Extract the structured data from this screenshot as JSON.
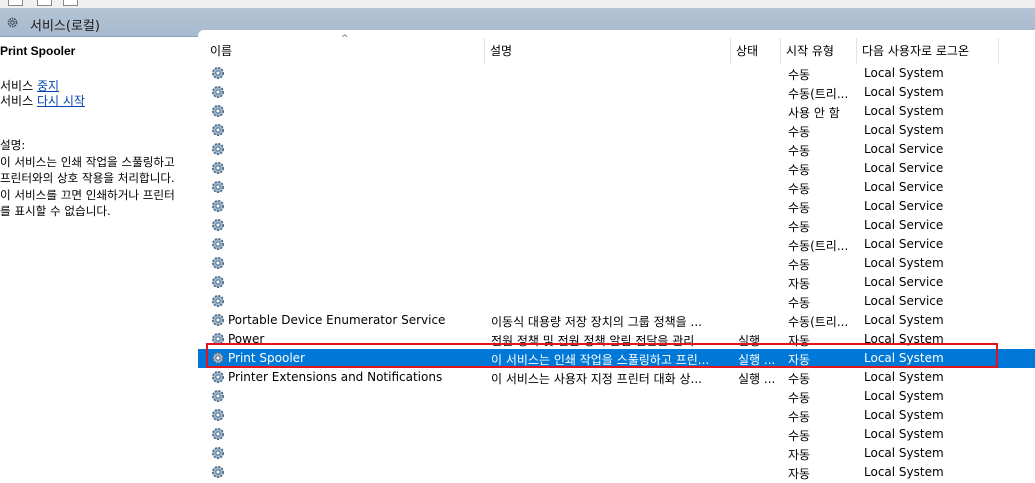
{
  "window": {
    "title": "서비스(로컬)"
  },
  "left_panel": {
    "service_title": "Print Spooler",
    "action_stop_prefix": "서비스 ",
    "action_stop_link": "중지",
    "action_restart_prefix": "서비스 ",
    "action_restart_link": "다시 시작",
    "desc_label": "설명:",
    "desc_lines": [
      "이 서비스는 인쇄 작업을 스풀링하고",
      "프린터와의 상호 작용을 처리합니다.",
      "이 서비스를 끄면 인쇄하거나 프린터",
      "를 표시할 수 없습니다."
    ]
  },
  "columns": {
    "name": "이름",
    "description": "설명",
    "status": "상태",
    "startup": "시작 유형",
    "logon": "다음 사용자로 로그온"
  },
  "services": [
    {
      "name": "",
      "description": "",
      "status": "",
      "startup": "수동",
      "logon": "Local System"
    },
    {
      "name": "",
      "description": "",
      "status": "",
      "startup": "수동(트리...",
      "logon": "Local System"
    },
    {
      "name": "",
      "description": "",
      "status": "",
      "startup": "사용 안 함",
      "logon": "Local System"
    },
    {
      "name": "",
      "description": "",
      "status": "",
      "startup": "수동",
      "logon": "Local System"
    },
    {
      "name": "",
      "description": "",
      "status": "",
      "startup": "수동",
      "logon": "Local Service"
    },
    {
      "name": "",
      "description": "",
      "status": "",
      "startup": "수동",
      "logon": "Local Service"
    },
    {
      "name": "",
      "description": "",
      "status": "",
      "startup": "수동",
      "logon": "Local Service"
    },
    {
      "name": "",
      "description": "",
      "status": "",
      "startup": "수동",
      "logon": "Local Service"
    },
    {
      "name": "",
      "description": "",
      "status": "",
      "startup": "수동",
      "logon": "Local Service"
    },
    {
      "name": "",
      "description": "",
      "status": "",
      "startup": "수동(트리...",
      "logon": "Local Service"
    },
    {
      "name": "",
      "description": "",
      "status": "",
      "startup": "수동",
      "logon": "Local System"
    },
    {
      "name": "",
      "description": "",
      "status": "",
      "startup": "자동",
      "logon": "Local Service"
    },
    {
      "name": "",
      "description": "",
      "status": "",
      "startup": "수동",
      "logon": "Local Service"
    },
    {
      "name": "Portable Device Enumerator Service",
      "description": "이동식 대용량 저장 장치의 그룹 정책을 ...",
      "status": "",
      "startup": "수동(트리...",
      "logon": "Local System"
    },
    {
      "name": "Power",
      "description": "전원 정책 및 전원 정책 알림 전달을 관리...",
      "status": "실행 ...",
      "startup": "자동",
      "logon": "Local System"
    },
    {
      "name": "Print Spooler",
      "description": "이 서비스는 인쇄 작업을 스풀링하고 프린...",
      "status": "실행 ...",
      "startup": "자동",
      "logon": "Local System",
      "selected": true
    },
    {
      "name": "Printer Extensions and Notifications",
      "description": "이 서비스는 사용자 지정 프린터 대화 상...",
      "status": "실행 ...",
      "startup": "수동",
      "logon": "Local System"
    },
    {
      "name": "",
      "description": "",
      "status": "",
      "startup": "수동",
      "logon": "Local System"
    },
    {
      "name": "",
      "description": "",
      "status": "",
      "startup": "수동",
      "logon": "Local System"
    },
    {
      "name": "",
      "description": "",
      "status": "",
      "startup": "수동",
      "logon": "Local System"
    },
    {
      "name": "",
      "description": "",
      "status": "",
      "startup": "자동",
      "logon": "Local System"
    },
    {
      "name": "",
      "description": "",
      "status": "",
      "startup": "자동",
      "logon": "Local System"
    }
  ],
  "colors": {
    "selection": "#0078d7",
    "highlight_border": "#e0141e",
    "link": "#0645ad"
  },
  "icons": {
    "service": "gear-icon"
  }
}
